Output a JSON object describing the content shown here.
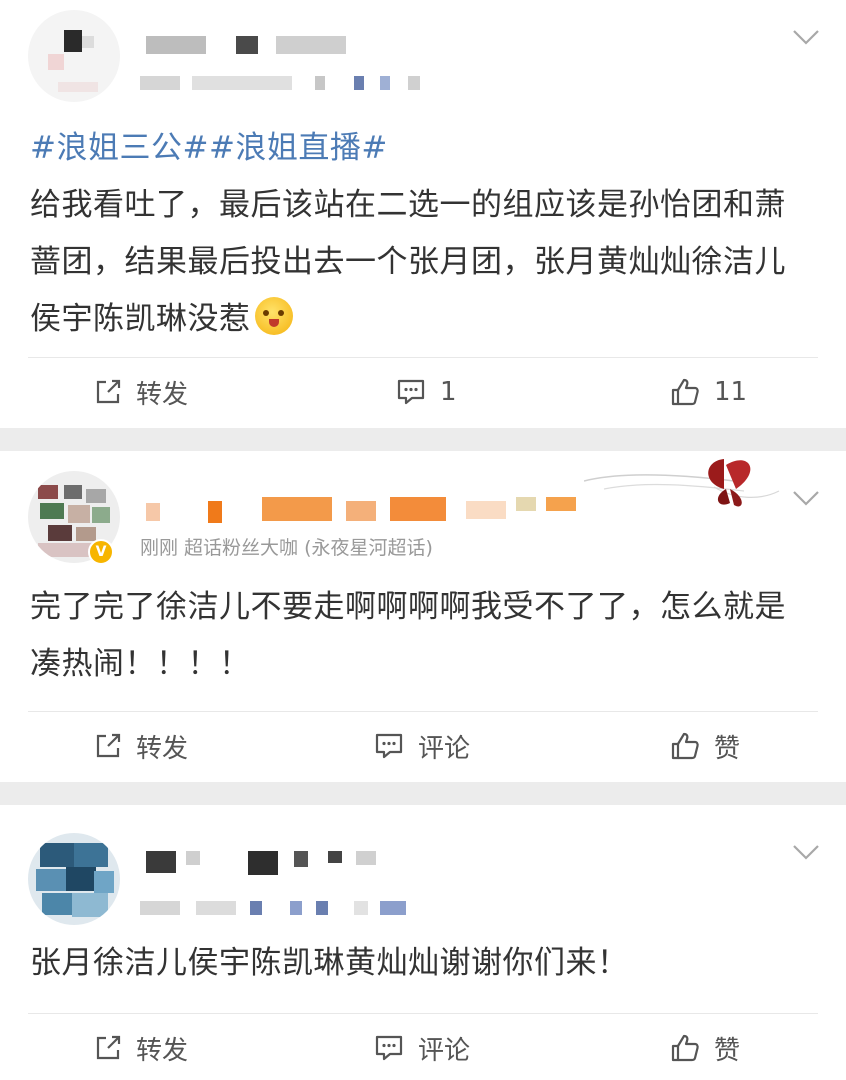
{
  "posts": [
    {
      "meta": "",
      "topics": "#浪姐三公##浪姐直播#",
      "text": "给我看吐了，最后该站在二选一的组应该是孙怡团和萧蔷团，结果最后投出去一个张月团，张月黄灿灿徐洁儿侯宇陈凯琳没惹",
      "actions": {
        "repost": "转发",
        "comment": "1",
        "like": "11"
      }
    },
    {
      "meta": "刚刚  超话粉丝大咖 (永夜星河超话)",
      "text": "完了完了徐洁儿不要走啊啊啊啊我受不了了，怎么就是凑热闹！！！！",
      "actions": {
        "repost": "转发",
        "comment": "评论",
        "like": "赞"
      }
    },
    {
      "meta": "",
      "text": "张月徐洁儿侯宇陈凯琳黄灿灿谢谢你们来！",
      "actions": {
        "repost": "转发",
        "comment": "评论",
        "like": "赞"
      }
    }
  ],
  "icons": {
    "repost": "share-square-icon",
    "comment": "comment-bubble-icon",
    "like": "thumbs-up-icon",
    "more": "chevron-down-icon",
    "emoji": "hugging-face-emoji",
    "vip": "verified-v-badge",
    "decoration": "butterfly-decoration"
  },
  "colors": {
    "topic": "#4c7bb5",
    "text": "#333333",
    "meta": "#999999",
    "separator": "#ececec",
    "badge": "#f7b500"
  }
}
